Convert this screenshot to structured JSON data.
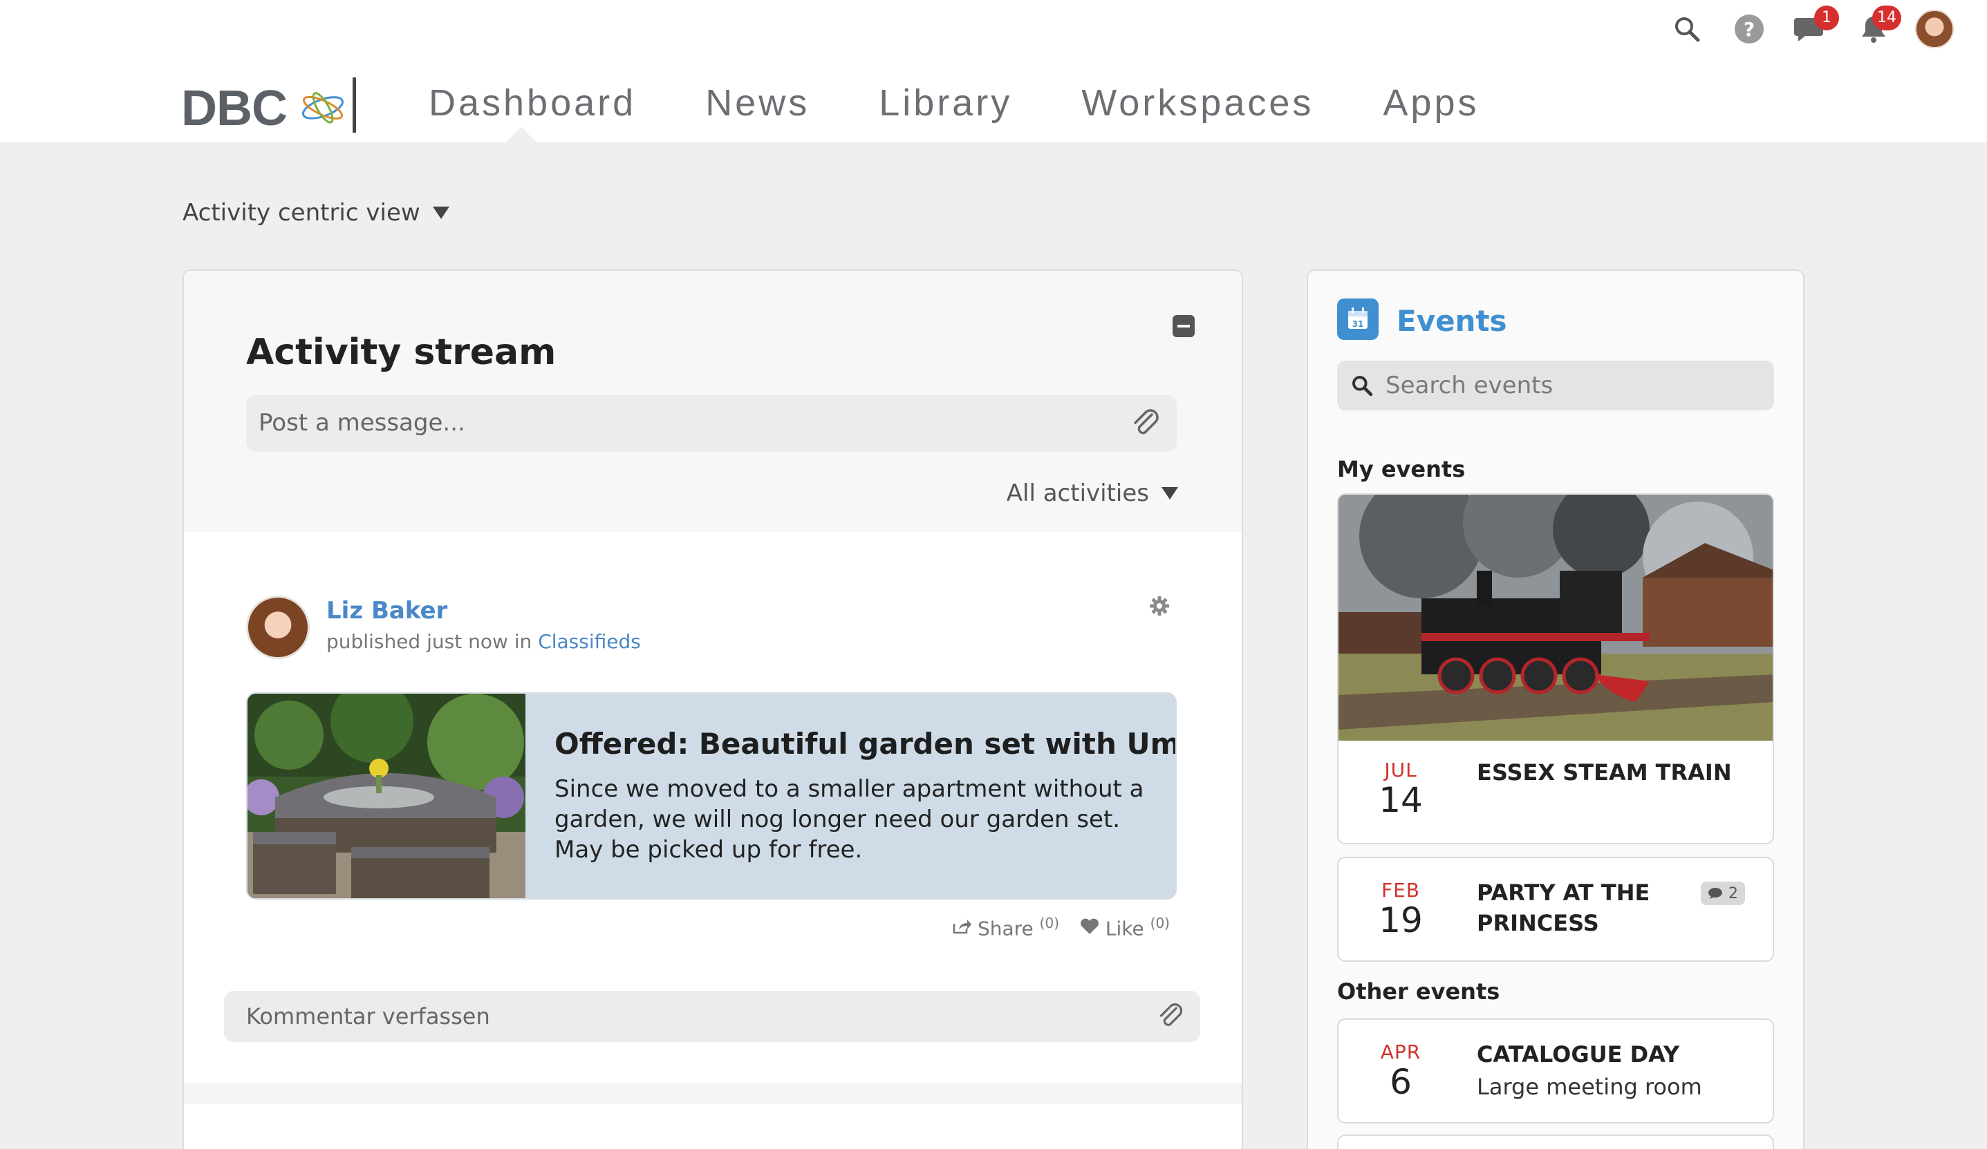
{
  "header": {
    "logo_text": "DBC",
    "nav": [
      "Dashboard",
      "News",
      "Library",
      "Workspaces",
      "Apps"
    ],
    "chat_badge": "1",
    "notif_badge": "14"
  },
  "view_select": "Activity centric view",
  "activity": {
    "title": "Activity stream",
    "post_placeholder": "Post a message...",
    "filter": "All activities",
    "post": {
      "author": "Liz Baker",
      "meta_prefix": "published just now in ",
      "meta_link": "Classifieds",
      "card_title": "Offered: Beautiful garden set with Umbrella",
      "card_text": "Since we moved to a smaller apartment without a garden, we will nog longer need our garden set. May be picked up for free.",
      "share_label": "Share",
      "share_count": "(0)",
      "like_label": "Like",
      "like_count": "(0)"
    },
    "comment_placeholder": "Kommentar verfassen"
  },
  "events": {
    "title": "Events",
    "search_placeholder": "Search events",
    "my_events_heading": "My events",
    "other_events_heading": "Other events",
    "calendar_day": "31",
    "my_events": [
      {
        "month": "JUL",
        "day": "14",
        "title": "ESSEX STEAM TRAIN"
      },
      {
        "month": "FEB",
        "day": "19",
        "title_line1": "PARTY AT THE",
        "title_line2": "PRINCESS",
        "comments": "2"
      }
    ],
    "other_events": [
      {
        "month": "APR",
        "day": "6",
        "title": "CATALOGUE DAY",
        "location": "Large meeting room"
      }
    ]
  }
}
